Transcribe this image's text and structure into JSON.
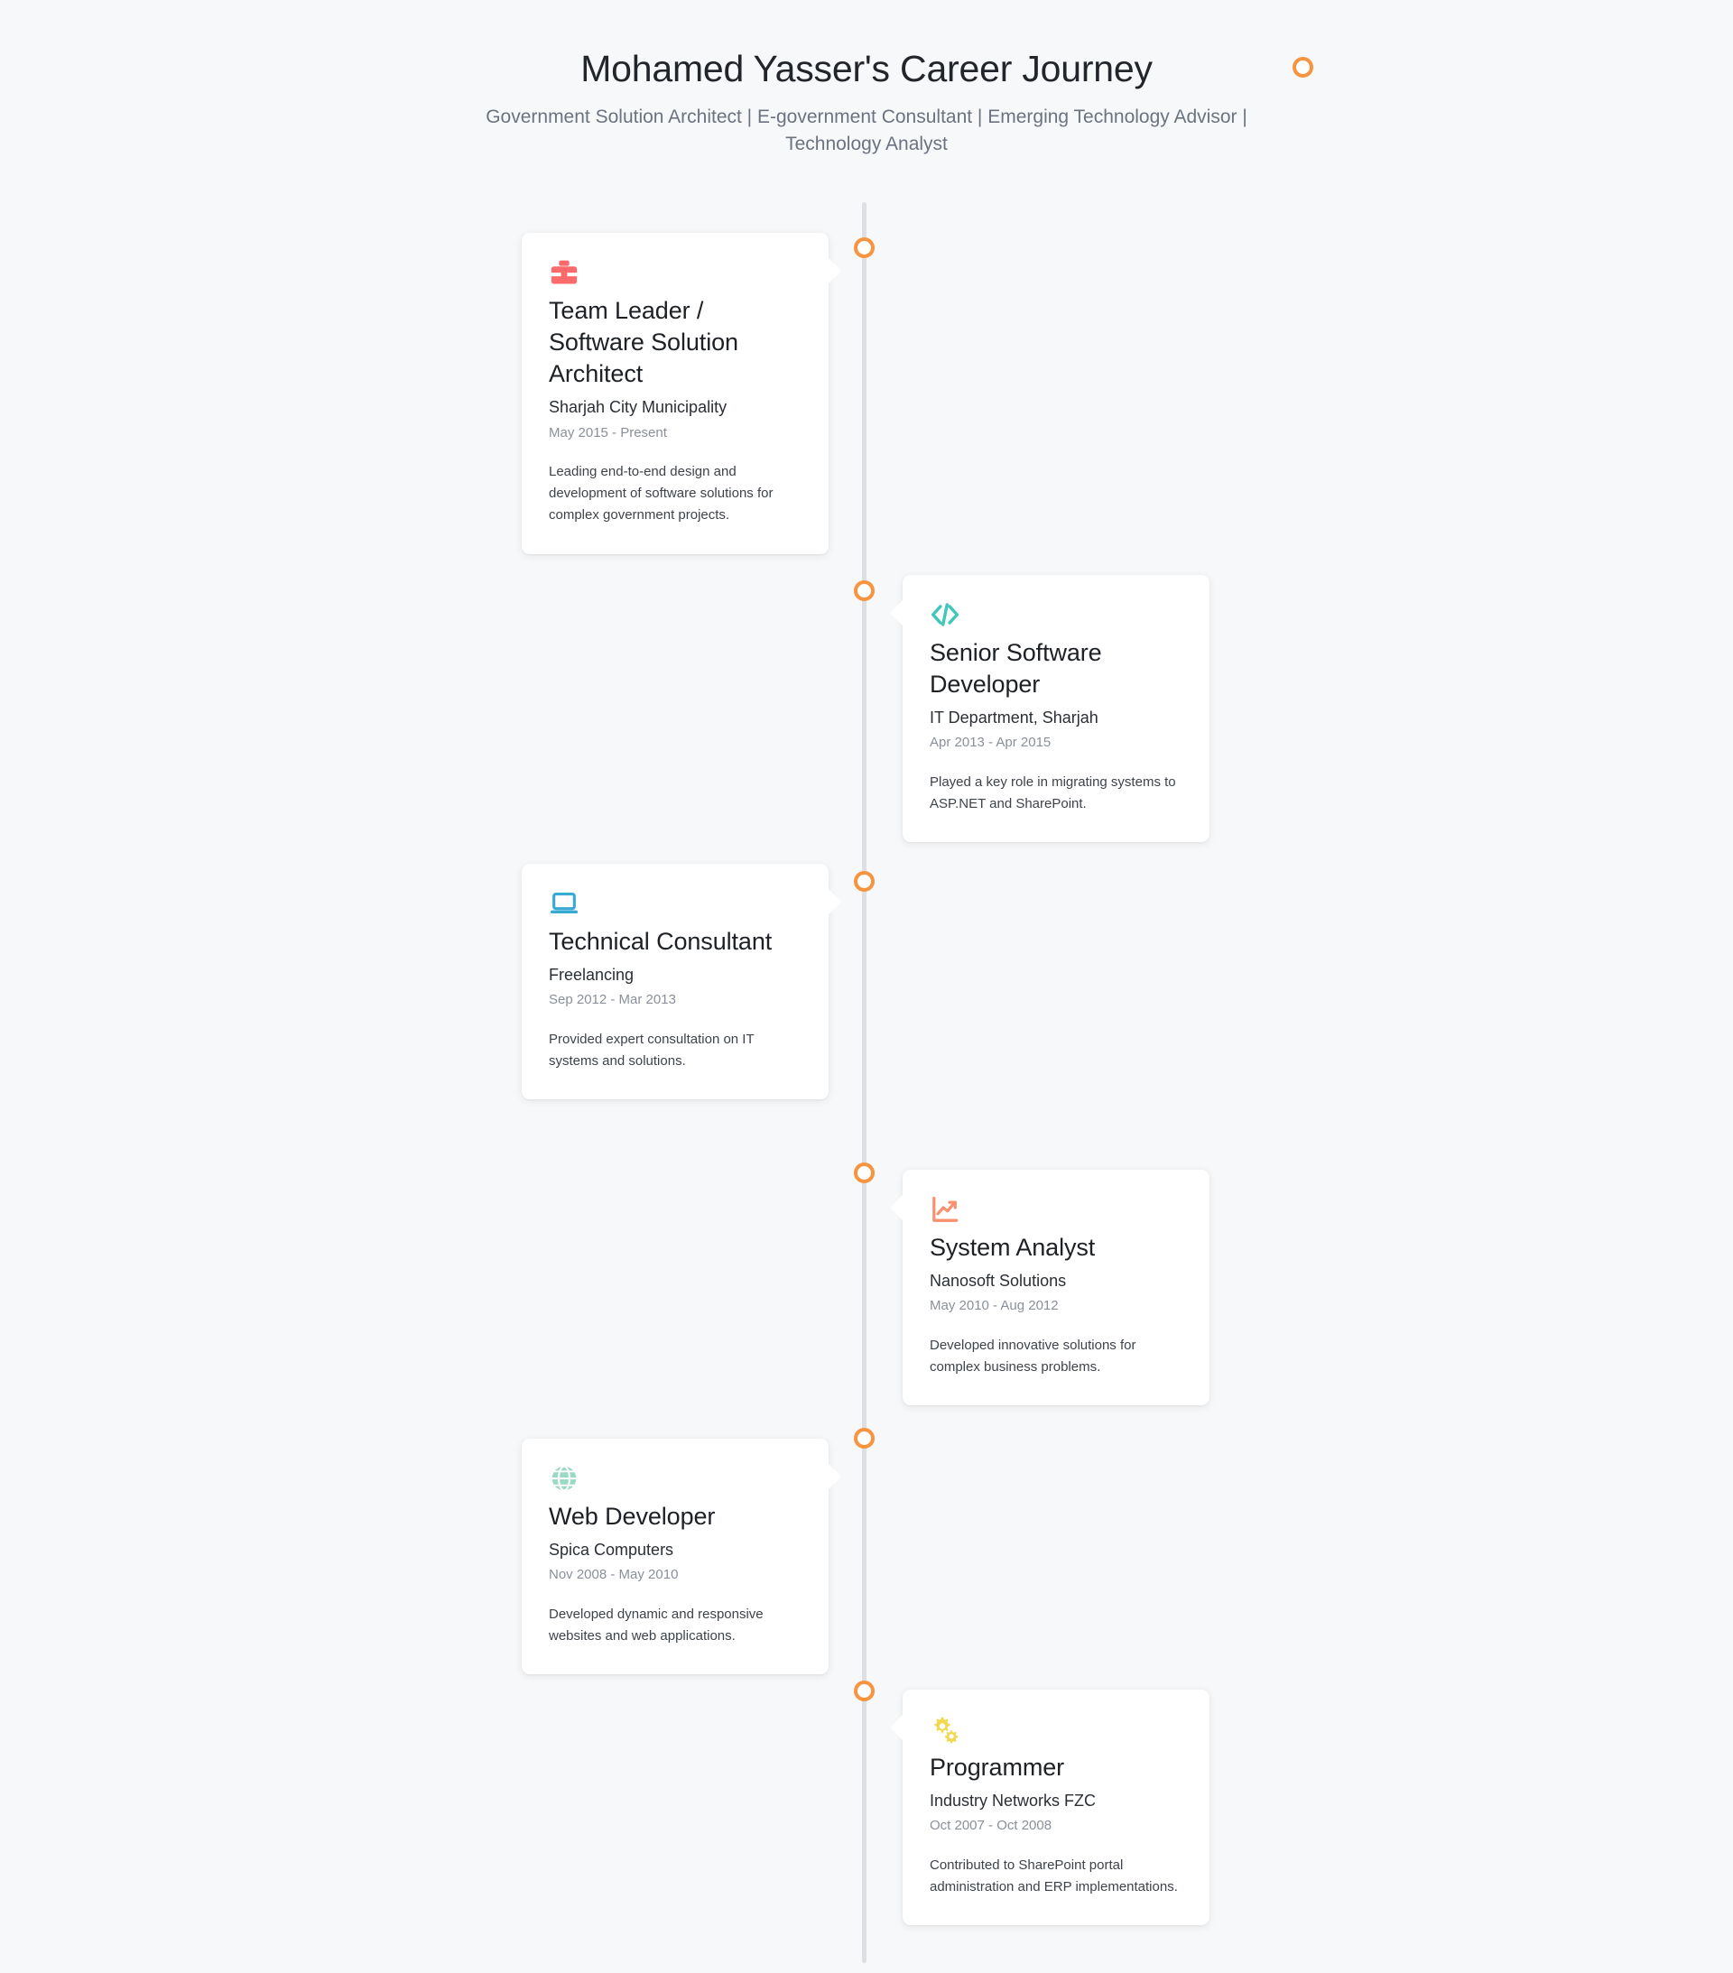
{
  "header": {
    "title": "Mohamed Yasser's Career Journey",
    "subtitle": "Government Solution Architect | E-government Consultant | Emerging Technology Advisor | Technology Analyst",
    "accent_color": "#f6943f",
    "background_color": "#f7f8fa"
  },
  "timeline": {
    "line_color": "#dddfe2",
    "dot_border_color": "#f6943f",
    "dot_fill_color": "#ffffff",
    "entry_count": 6
  },
  "entries": [
    {
      "side": "left",
      "icon": "briefcase-icon",
      "icon_color": "#fb6b6b",
      "role": "Team Leader / Software Solution Architect",
      "organization": "Sharjah City Municipality",
      "period": "May 2015 - Present",
      "description": "Leading end-to-end design and development of software solutions for complex government projects."
    },
    {
      "side": "right",
      "icon": "code-brackets-icon",
      "icon_color": "#3fc8ba",
      "role": "Senior Software Developer",
      "organization": "IT Department, Sharjah",
      "period": "Apr 2013 - Apr 2015",
      "description": "Played a key role in migrating systems to ASP.NET and SharePoint."
    },
    {
      "side": "left",
      "icon": "laptop-icon",
      "icon_color": "#36a9d4",
      "role": "Technical Consultant",
      "organization": "Freelancing",
      "period": "Sep 2012 - Mar 2013",
      "description": "Provided expert consultation on IT systems and solutions."
    },
    {
      "side": "right",
      "icon": "chart-line-icon",
      "icon_color": "#f99070",
      "role": "System Analyst",
      "organization": "Nanosoft Solutions",
      "period": "May 2010 - Aug 2012",
      "description": "Developed innovative solutions for complex business problems."
    },
    {
      "side": "left",
      "icon": "globe-icon",
      "icon_color": "#9ad9c4",
      "role": "Web Developer",
      "organization": "Spica Computers",
      "period": "Nov 2008 - May 2010",
      "description": "Developed dynamic and responsive websites and web applications."
    },
    {
      "side": "right",
      "icon": "gears-icon",
      "icon_color": "#f3d74e",
      "role": "Programmer",
      "organization": "Industry Networks FZC",
      "period": "Oct 2007 - Oct 2008",
      "description": "Contributed to SharePoint portal administration and ERP implementations."
    }
  ]
}
